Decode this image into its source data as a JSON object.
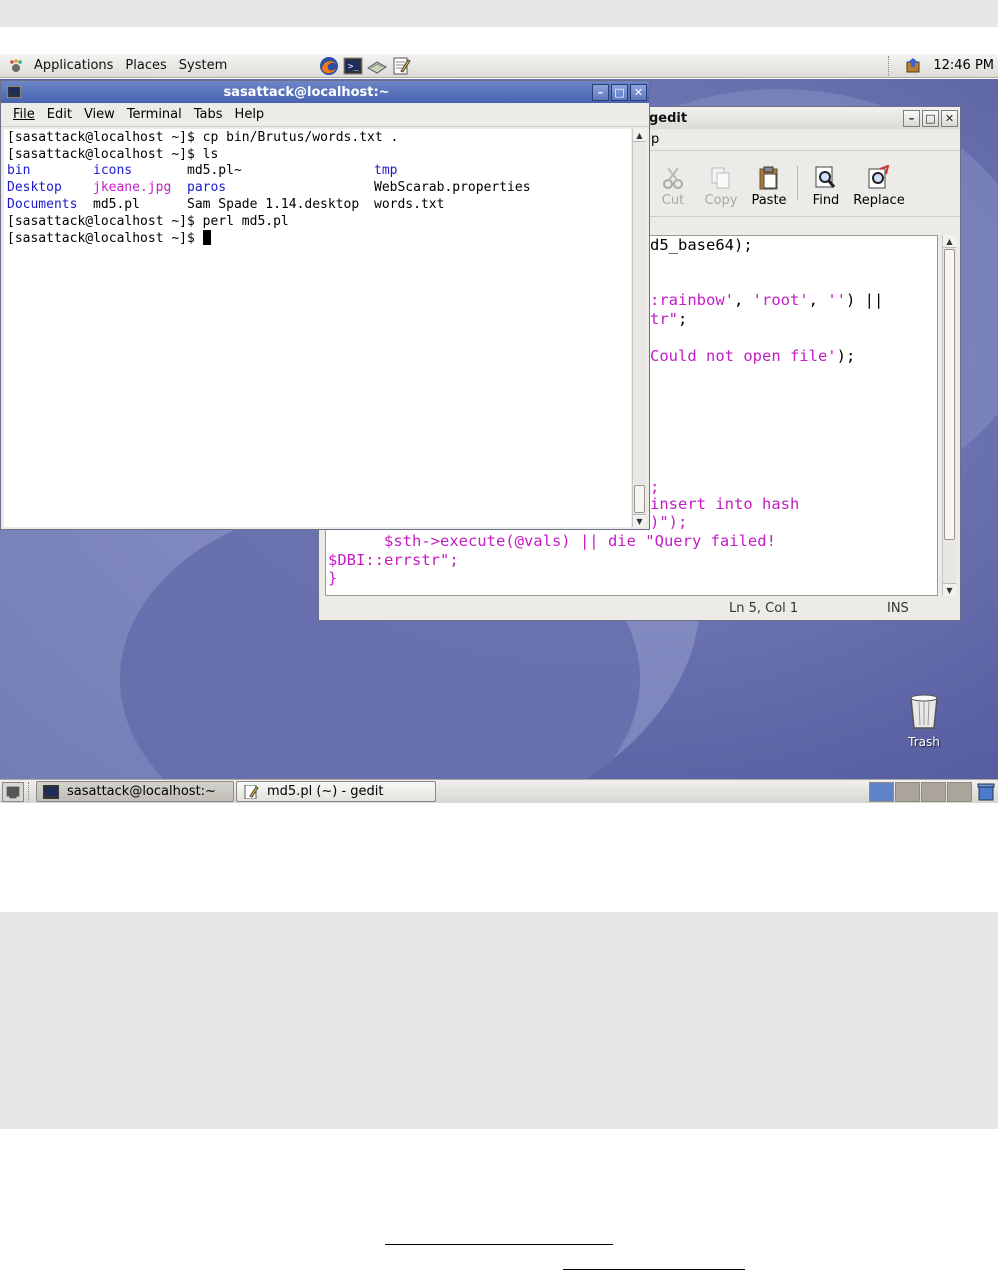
{
  "top_panel": {
    "menus": [
      "Applications",
      "Places",
      "System"
    ],
    "launchers": [
      "firefox-icon",
      "terminal-icon",
      "disk-icon",
      "edit-icon"
    ],
    "clock": "12:46 PM"
  },
  "terminal": {
    "title": "sasattack@localhost:~",
    "menu": [
      "File",
      "Edit",
      "View",
      "Terminal",
      "Tabs",
      "Help"
    ],
    "lines": {
      "l1": "[sasattack@localhost ~]$ cp bin/Brutus/words.txt .",
      "l2": "[sasattack@localhost ~]$ ls",
      "ls_row1": [
        "bin",
        "icons",
        "md5.pl~",
        "tmp"
      ],
      "ls_row2": [
        "Desktop",
        "jkeane.jpg",
        "paros",
        "WebScarab.properties"
      ],
      "ls_row3": [
        "Documents",
        "md5.pl",
        "Sam Spade 1.14.desktop",
        "words.txt"
      ],
      "l6": "[sasattack@localhost ~]$ perl md5.pl",
      "l7": "[sasattack@localhost ~]$ "
    }
  },
  "gedit": {
    "title": "gedit",
    "menu_fragment": "p",
    "toolbar": [
      "Cut",
      "Copy",
      "Paste",
      "Find",
      "Replace"
    ],
    "code": {
      "c1": "d5_base64);",
      "c2a": ":rainbow'",
      "c2b": ", ",
      "c2c": "'root'",
      "c2d": ", ",
      "c2e": "''",
      "c2f": ") ||",
      "c3a": "tr\"",
      "c3b": ";",
      "c4a": "Could not open file'",
      "c4b": ");",
      "c5": ";",
      "c6": "insert into hash",
      "c7": ")\");",
      "c8": "      $sth->execute(@vals) || die \"Query failed!",
      "c9": "$DBI::errstr\";",
      "c10": "}"
    },
    "status": {
      "position": "Ln 5, Col 1",
      "mode": "INS"
    }
  },
  "desktop": {
    "trash_label": "Trash"
  },
  "taskbar": {
    "tasks": [
      "sasattack@localhost:~",
      "md5.pl (~) - gedit"
    ],
    "workspaces": 4
  }
}
